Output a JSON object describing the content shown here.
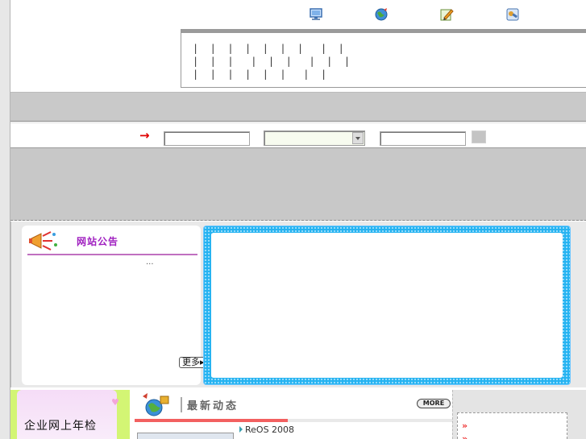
{
  "colors": {
    "accent_red": "#e00000",
    "notice_title": "#a020c0",
    "banner_blue": "#25b3f1",
    "annual_green": "#d3f574"
  },
  "top_icons": [
    "monitor-icon",
    "globe-icon",
    "pencil-icon",
    "tools-icon"
  ],
  "links": {
    "rows": [
      "|  |  |  |  |  |  |   |  |",
      "|  |  |   |  |  |   |  |  |",
      "|  |  |  |  |  |   |  |"
    ]
  },
  "search": {
    "arrow": "→",
    "keyword_value": "",
    "select_value": "",
    "extra_value": ""
  },
  "notice": {
    "icon": "megaphone-icon",
    "title": "网站公告",
    "ellipsis": "...",
    "more_label": "更多▸"
  },
  "annual": {
    "text": "企业网上年检",
    "heart": "♥"
  },
  "news": {
    "icon": "globe-gift-icon",
    "title": "最新动态",
    "more_label": "MORE",
    "item": "ReOS 2008"
  },
  "side": {
    "arrow1": "»",
    "arrow2": "»"
  }
}
